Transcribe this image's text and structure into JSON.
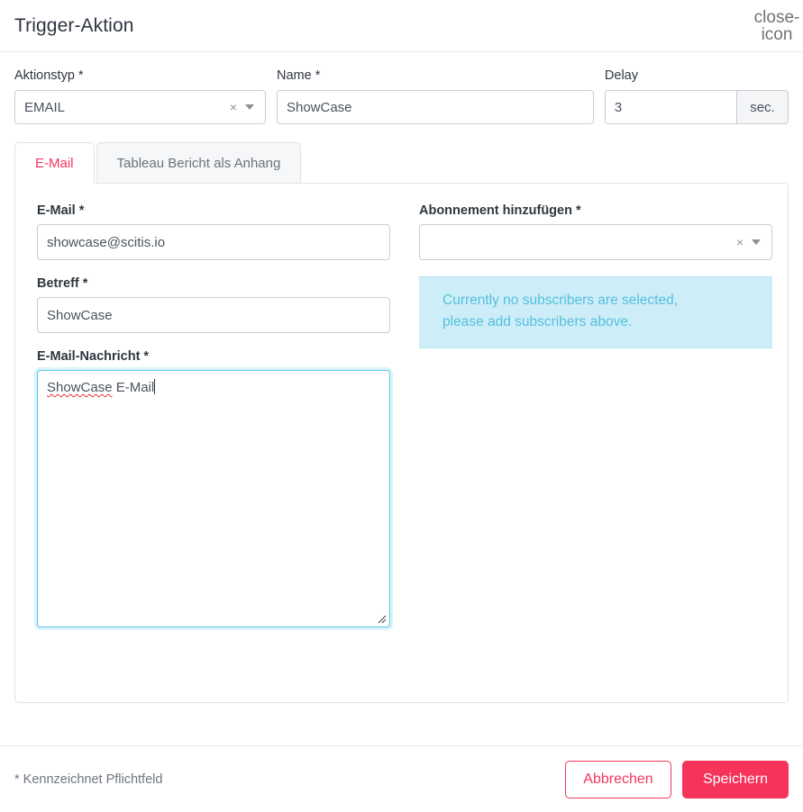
{
  "dialog": {
    "title": "Trigger-Aktion",
    "close_icon": "close-icon"
  },
  "top_fields": {
    "action_type": {
      "label": "Aktionstyp *",
      "value": "EMAIL",
      "clear_icon": "×",
      "caret_icon": "chevron-down-icon"
    },
    "name": {
      "label": "Name *",
      "value": "ShowCase"
    },
    "delay": {
      "label": "Delay",
      "value": "3",
      "unit": "sec."
    }
  },
  "tabs": [
    {
      "label": "E-Mail",
      "active": true
    },
    {
      "label": "Tableau Bericht als Anhang",
      "active": false
    }
  ],
  "email_tab": {
    "email": {
      "label": "E-Mail *",
      "value": "showcase@scitis.io"
    },
    "subject": {
      "label": "Betreff *",
      "value": "ShowCase"
    },
    "message": {
      "label": "E-Mail-Nachricht *",
      "value_misspelled": "ShowCase",
      "value_rest": " E-Mail"
    },
    "subscription": {
      "label": "Abonnement hinzufügen *",
      "value": "",
      "clear_icon": "×",
      "caret_icon": "chevron-down-icon"
    },
    "info_line_1": "Currently no subscribers are selected,",
    "info_line_2": "please add subscribers above."
  },
  "footer": {
    "note": "* Kennzeichnet Pflichtfeld",
    "cancel_label": "Abbrechen",
    "save_label": "Speichern"
  },
  "colors": {
    "brand": "#f5335b",
    "info_bg": "#cdeef8",
    "info_text": "#54bfdf",
    "focus_border": "#5bc8e8"
  }
}
